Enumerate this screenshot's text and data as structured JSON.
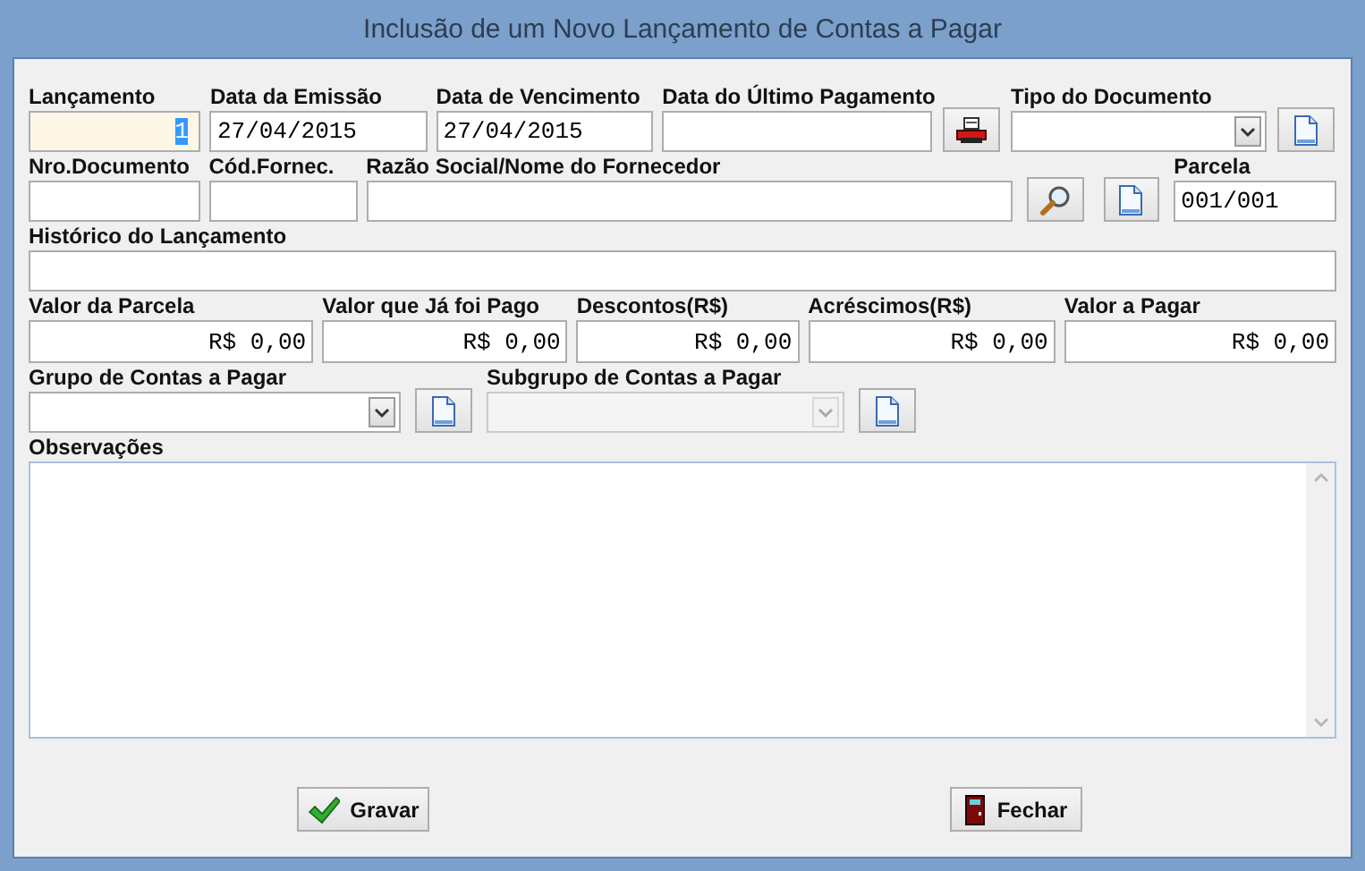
{
  "window": {
    "title": "Inclusão de um Novo Lançamento de Contas a Pagar"
  },
  "rows": [
    {
      "fields": [
        {
          "kind": "number",
          "label": "Lançamento",
          "value": "1",
          "focused": true
        },
        {
          "kind": "input",
          "label": "Data da Emissão",
          "value": "27/04/2015"
        },
        {
          "kind": "input",
          "label": "Data de Vencimento",
          "value": "27/04/2015"
        },
        {
          "kind": "input",
          "label": "Data do Último Pagamento"
        },
        {
          "kind": "select",
          "label": "Tipo do Documento",
          "disabled": false
        }
      ]
    },
    {
      "fields": [
        {
          "kind": "input",
          "label": "Nro.Documento"
        },
        {
          "kind": "input",
          "label": "Cód.Fornec."
        },
        {
          "kind": "input",
          "label": "Razão Social/Nome do Fornecedor"
        },
        {
          "kind": "input",
          "label": "Parcela",
          "value": "001/001"
        }
      ]
    },
    {
      "fields": [
        {
          "kind": "input",
          "label": "Histórico do Lançamento"
        }
      ]
    },
    {
      "fields": [
        {
          "kind": "number",
          "label": "Valor da Parcela",
          "value": "R$ 0,00"
        },
        {
          "kind": "number",
          "label": "Valor que Já foi Pago",
          "value": "R$ 0,00"
        },
        {
          "kind": "number",
          "label": "Descontos(R$)",
          "value": "R$ 0,00"
        },
        {
          "kind": "number",
          "label": "Acréscimos(R$)",
          "value": "R$ 0,00"
        },
        {
          "kind": "number",
          "label": "Valor a Pagar",
          "value": "R$ 0,00"
        }
      ]
    },
    {
      "fields": [
        {
          "kind": "select",
          "label": "Grupo de Contas a Pagar",
          "disabled": false
        },
        {
          "kind": "select",
          "label": "Subgrupo de Contas a Pagar",
          "disabled": true
        }
      ]
    },
    {
      "fields": [
        {
          "kind": "textarea",
          "label": "Observações"
        }
      ]
    }
  ],
  "buttons": [
    {
      "kind": "save",
      "label": "Gravar"
    },
    {
      "kind": "close",
      "label": "Fechar"
    }
  ]
}
